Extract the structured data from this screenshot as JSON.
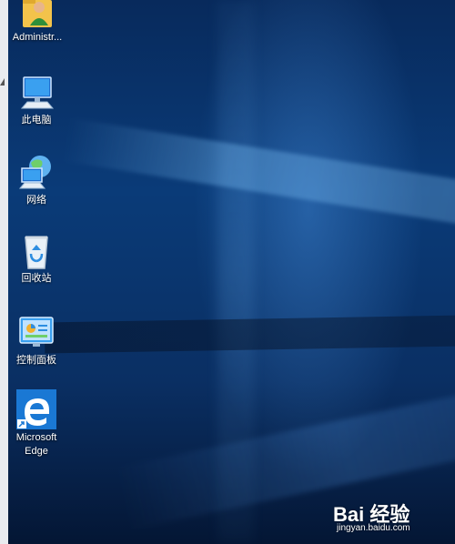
{
  "desktop_icons": [
    {
      "label": "Administr...",
      "icon": "user-folder-icon"
    },
    {
      "label": "此电脑",
      "icon": "this-pc-icon"
    },
    {
      "label": "网络",
      "icon": "network-icon"
    },
    {
      "label": "回收站",
      "icon": "recycle-bin-icon"
    },
    {
      "label": "控制面板",
      "icon": "control-panel-icon"
    },
    {
      "label": "Microsoft Edge",
      "icon": "edge-icon"
    }
  ],
  "watermark": {
    "main": "Bai 经验",
    "sub": "jingyan.baidu.com"
  },
  "colors": {
    "desktop_dark": "#041634",
    "desktop_mid": "#0a3b78",
    "edge_blue": "#1a78d4"
  }
}
